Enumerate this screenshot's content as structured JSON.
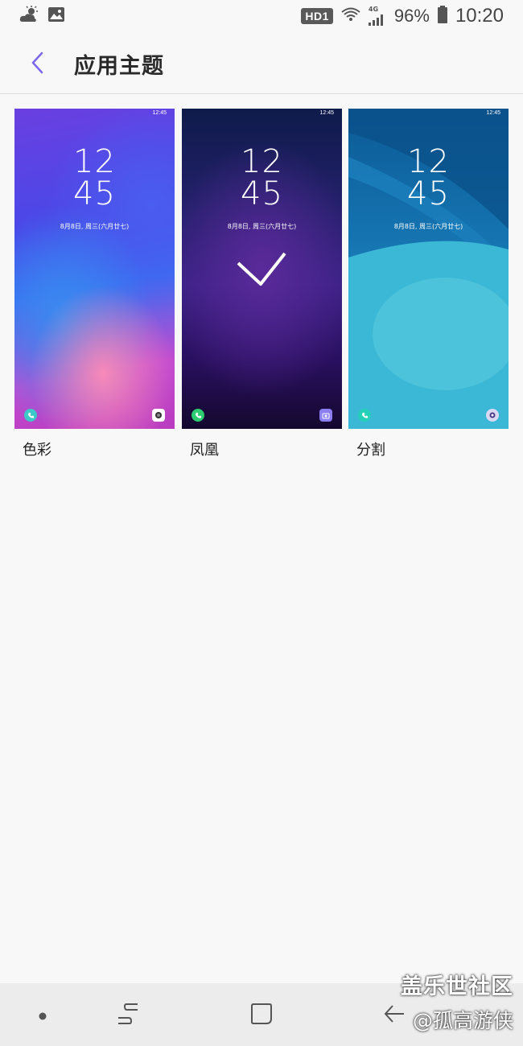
{
  "status_bar": {
    "hd_badge": "HD1",
    "network": "4G",
    "battery": "96%",
    "time": "10:20",
    "icons": [
      "weather-cloud-sun-icon",
      "image-icon",
      "wifi-icon",
      "signal-icon",
      "battery-icon"
    ]
  },
  "header": {
    "title": "应用主题",
    "back_icon": "chevron-left-icon"
  },
  "themes": [
    {
      "name": "色彩",
      "clock_hour": "12",
      "clock_min": "45",
      "date": "8月8日, 周三(六月廿七)",
      "mini_time": "12:45",
      "selected": false
    },
    {
      "name": "凤凰",
      "clock_hour": "12",
      "clock_min": "45",
      "date": "8月8日, 周三(六月廿七)",
      "mini_time": "12:45",
      "selected": true
    },
    {
      "name": "分割",
      "clock_hour": "12",
      "clock_min": "45",
      "date": "8月8日, 周三(六月廿七)",
      "mini_time": "12:45",
      "selected": false
    }
  ],
  "nav_bar": {
    "icons": [
      "dot-icon",
      "recents-icon",
      "home-icon",
      "back-icon"
    ]
  },
  "watermark": {
    "line1": "盖乐世社区",
    "line2": "@孤高游侠"
  },
  "colors": {
    "accent": "#7b68ee",
    "background": "#f8f8f8"
  }
}
